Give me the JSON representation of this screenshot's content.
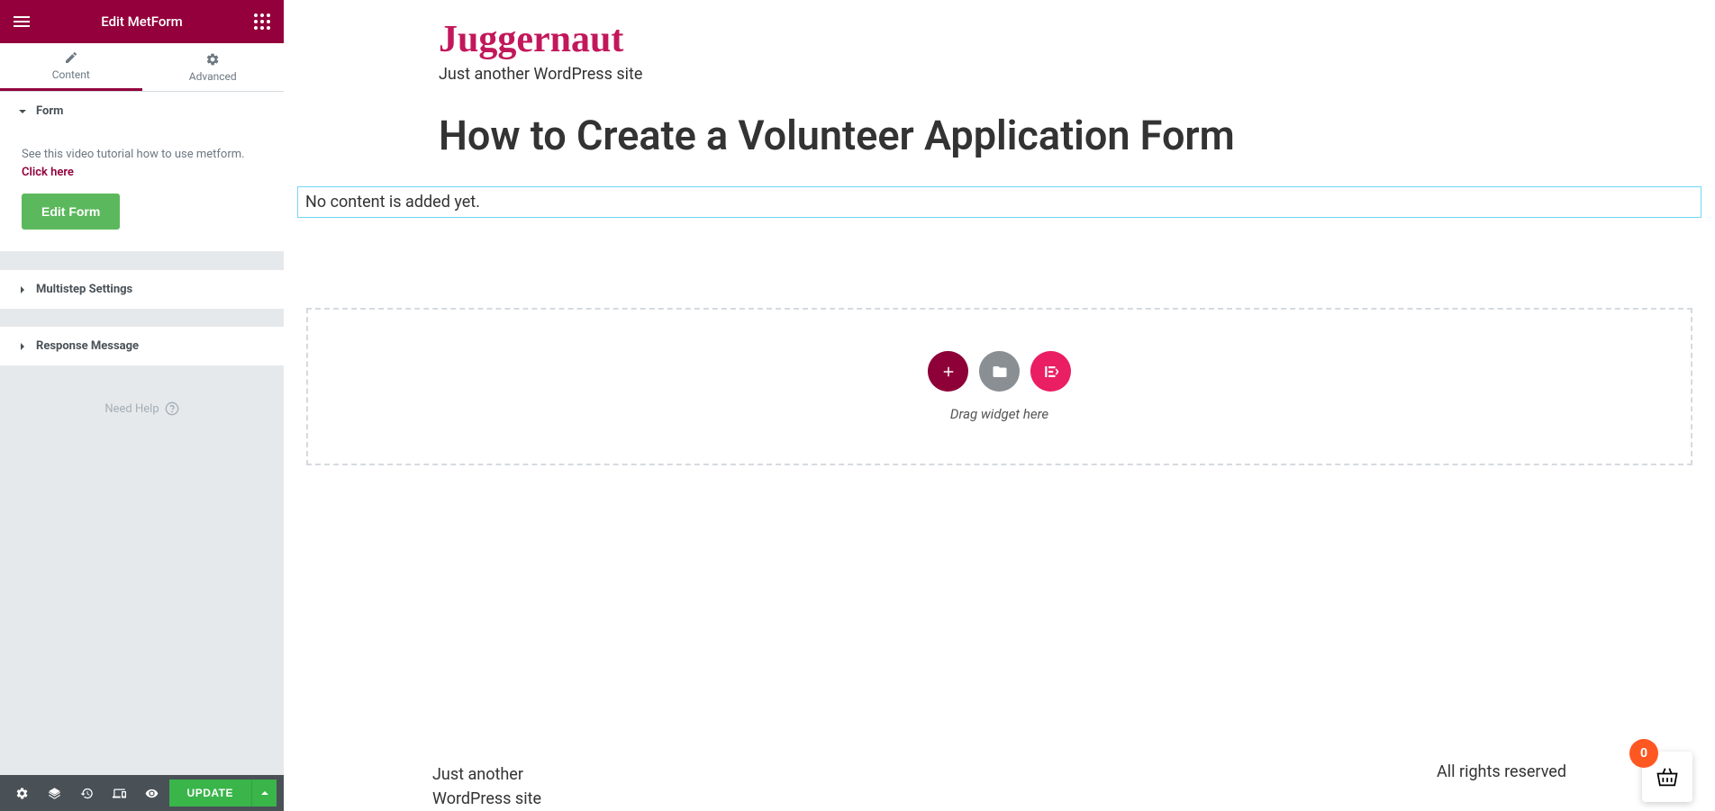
{
  "sidebar": {
    "header_title": "Edit MetForm",
    "tabs": {
      "content": "Content",
      "advanced": "Advanced"
    },
    "sections": {
      "form": {
        "title": "Form",
        "tutorial_text": "See this video tutorial how to use metform. ",
        "tutorial_link": "Click here",
        "edit_form_btn": "Edit Form"
      },
      "multistep": "Multistep Settings",
      "response": "Response Message"
    },
    "need_help": "Need Help",
    "footer": {
      "update_btn": "UPDATE"
    }
  },
  "preview": {
    "site_title": "Juggernaut",
    "site_tagline": "Just another WordPress site",
    "page_title": "How to Create a Volunteer Application Form",
    "no_content": "No content is added yet.",
    "drag_hint": "Drag widget here",
    "footer_tagline": "Just another WordPress site",
    "footer_rights": "All rights reserved",
    "cart_count": "0"
  }
}
